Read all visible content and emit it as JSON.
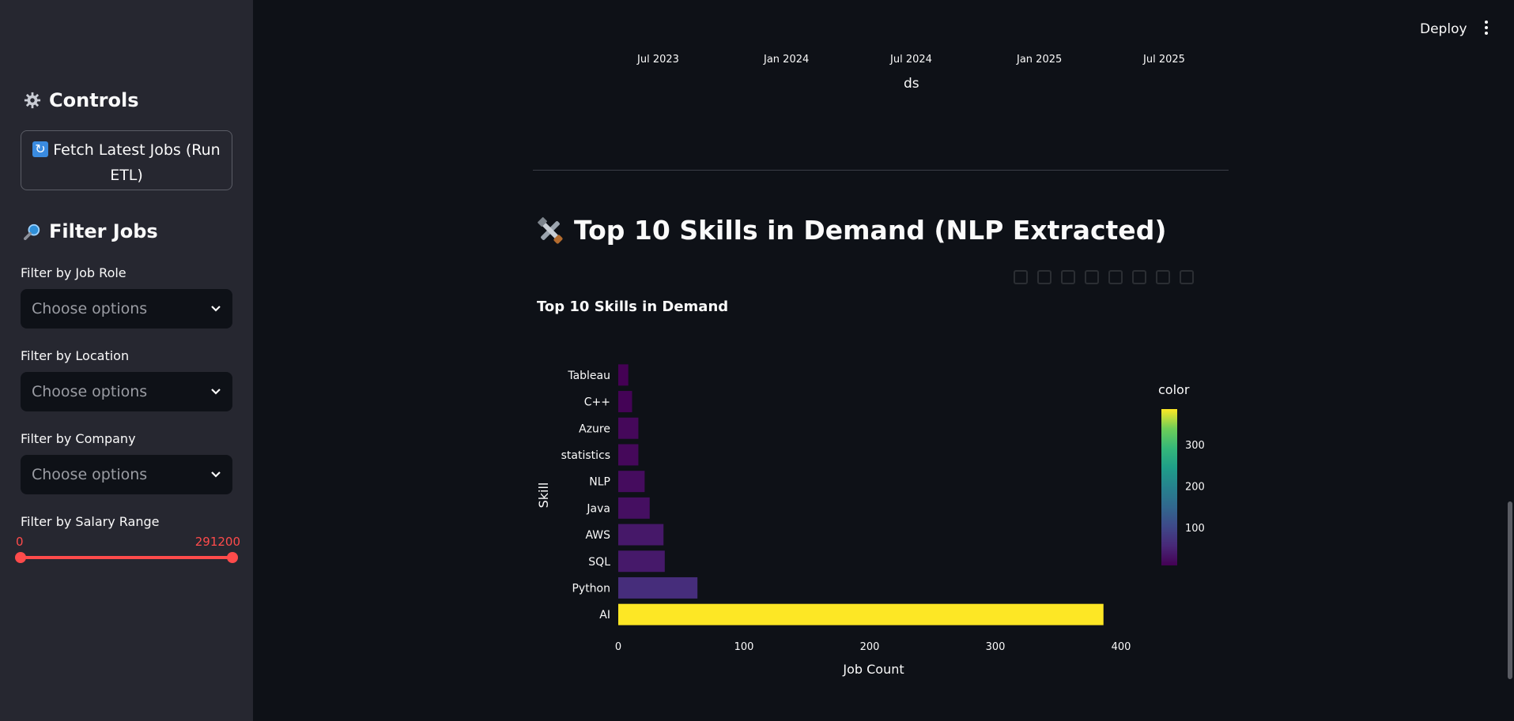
{
  "header": {
    "deploy_label": "Deploy"
  },
  "sidebar": {
    "controls_title": "Controls",
    "fetch_button": "Fetch Latest Jobs (Run ETL)",
    "filter_title": "Filter Jobs",
    "filters": [
      {
        "label": "Filter by Job Role",
        "placeholder": "Choose options"
      },
      {
        "label": "Filter by Location",
        "placeholder": "Choose options"
      },
      {
        "label": "Filter by Company",
        "placeholder": "Choose options"
      }
    ],
    "salary": {
      "label": "Filter by Salary Range",
      "min": "0",
      "max": "291200",
      "range_low": 0,
      "range_high": 1
    }
  },
  "main": {
    "prev_chart": {
      "x_ticks": [
        "Jul 2023",
        "Jan 2024",
        "Jul 2024",
        "Jan 2025",
        "Jul 2025"
      ],
      "xlabel": "ds"
    },
    "section_title": "Top 10 Skills in Demand (NLP Extracted)"
  },
  "chart_data": {
    "type": "bar",
    "orientation": "horizontal",
    "title": "Top 10 Skills in Demand",
    "xlabel": "Job Count",
    "ylabel": "Skill",
    "categories": [
      "Tableau",
      "C++",
      "Azure",
      "statistics",
      "NLP",
      "Java",
      "AWS",
      "SQL",
      "Python",
      "AI"
    ],
    "values": [
      8,
      11,
      16,
      16,
      21,
      25,
      36,
      37,
      63,
      386
    ],
    "xlim": [
      0,
      400
    ],
    "x_ticks": [
      0,
      100,
      200,
      300,
      400
    ],
    "colorbar": {
      "title": "color",
      "ticks": [
        100,
        200,
        300
      ],
      "min": 8,
      "max": 386,
      "colorscale": "viridis"
    },
    "grid": false
  }
}
